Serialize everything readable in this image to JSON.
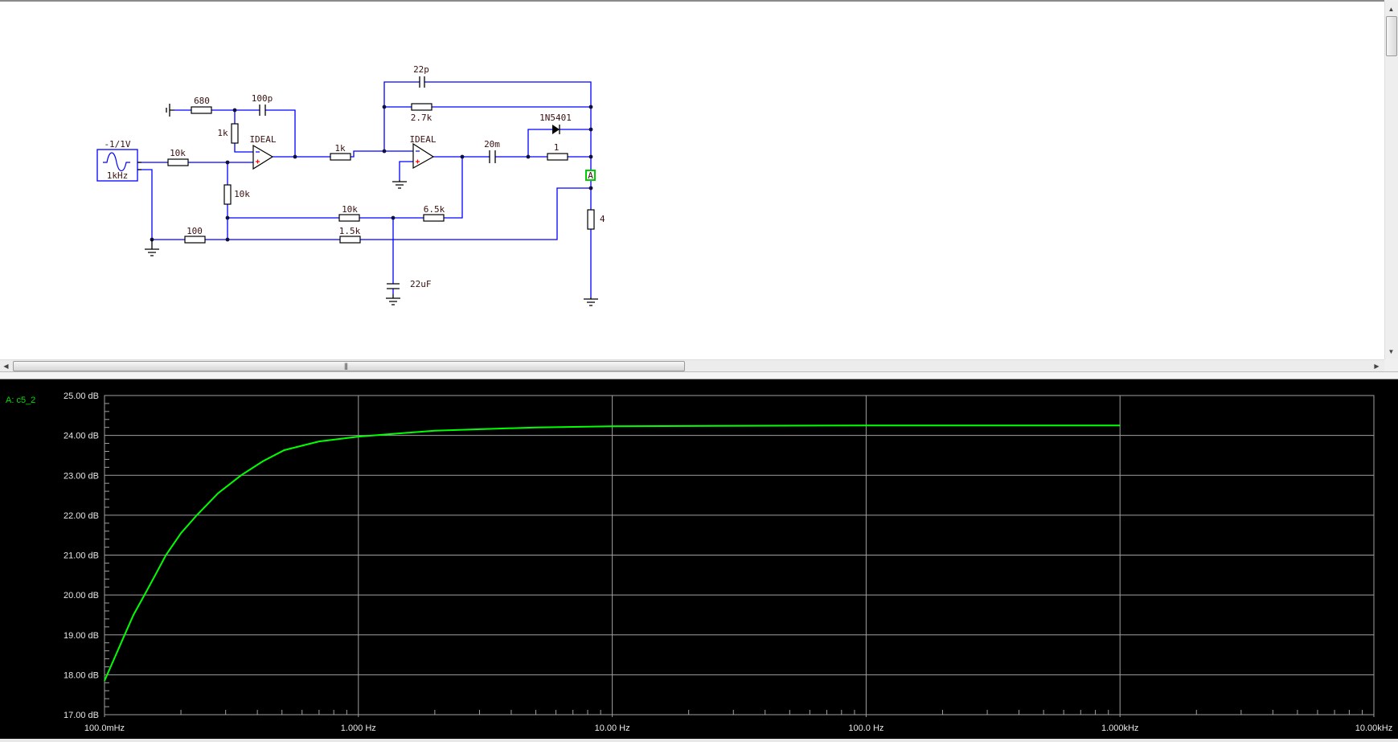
{
  "schematic": {
    "source": {
      "amplitude": "-1/1V",
      "frequency": "1kHz"
    },
    "opamp1": "IDEAL",
    "opamp2": "IDEAL",
    "r_680": "680",
    "c_100p": "100p",
    "r_1k_a": "1k",
    "r_10k_in": "10k",
    "r_10k_vert": "10k",
    "r_100": "100",
    "r_1k_b": "1k",
    "r_10k_mid": "10k",
    "r_1_5k": "1.5k",
    "c_22uF": "22uF",
    "c_22p": "22p",
    "r_2_7k": "2.7k",
    "c_20m": "20m",
    "diode": "1N5401",
    "r_1": "1",
    "r_6_5k": "6.5k",
    "r_4": "4",
    "probe": "A"
  },
  "colors": {
    "wire": "#0000ff",
    "trace": "#00ff00",
    "grid": "#a0a0a0",
    "probe": "#00cc00"
  },
  "chart_data": {
    "type": "line",
    "legend": "A: c5_2",
    "x_scale": "log",
    "xlim": [
      0.1,
      10000
    ],
    "ylim": [
      17,
      25
    ],
    "xtick_values": [
      0.1,
      1,
      10,
      100,
      1000,
      10000
    ],
    "xtick_labels": [
      "100.0mHz",
      "1.000 Hz",
      "10.00 Hz",
      "100.0 Hz",
      "1.000kHz",
      "10.00kHz"
    ],
    "ytick_values": [
      25,
      24,
      23,
      22,
      21,
      20,
      19,
      18,
      17
    ],
    "ytick_labels": [
      "25.00 dB",
      "24.00 dB",
      "23.00 dB",
      "22.00 dB",
      "21.00 dB",
      "20.00 dB",
      "19.00 dB",
      "18.00 dB",
      "17.00 dB"
    ],
    "grid": true,
    "series": [
      {
        "name": "A: c5_2",
        "x": [
          0.1,
          0.11,
          0.12,
          0.13,
          0.1437,
          0.16,
          0.1745,
          0.2,
          0.231,
          0.28,
          0.345,
          0.42,
          0.51,
          0.7,
          1,
          2,
          5,
          10,
          100,
          1000
        ],
        "y": [
          17.85,
          18.45,
          19.0,
          19.5,
          20.0,
          20.55,
          21.0,
          21.55,
          22.0,
          22.55,
          23.0,
          23.35,
          23.63,
          23.85,
          23.97,
          24.12,
          24.2,
          24.23,
          24.25,
          24.25
        ]
      }
    ]
  }
}
